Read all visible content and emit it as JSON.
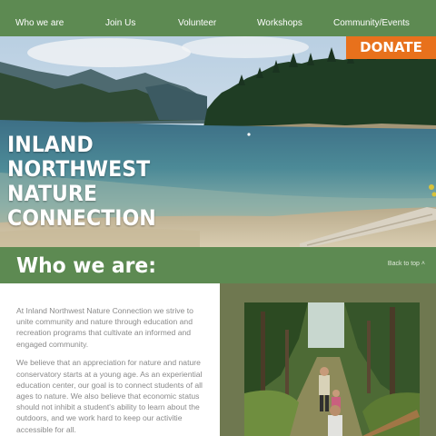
{
  "nav": {
    "items": [
      {
        "label": "Who we are"
      },
      {
        "label": "Join Us"
      },
      {
        "label": "Volunteer"
      },
      {
        "label": "Workshops"
      },
      {
        "label": "Community/Events"
      }
    ]
  },
  "donate_label": "DONATE",
  "hero": {
    "title_lines": [
      "INLAND",
      "NORTHWEST",
      "NATURE",
      "CONNECTION"
    ]
  },
  "section": {
    "title": "Who we are:",
    "back_link": "Back to top"
  },
  "body": {
    "paragraph_1": "At Inland Northwest Nature Connection we strive to unite community and nature through education and recreation programs that cultivate an informed and engaged community.",
    "paragraph_2": "We believe that an appreciation for nature and nature conservatory starts at a young age. As an experiential education center, our goal is to connect students of all ages to nature.  We also believe that economic status should not inhibit a student's ability to learn about the outdoors, and we work hard to keep our activitie accessible for all."
  },
  "colors": {
    "nav_green": "#5d8a52",
    "donate_orange": "#e8711c",
    "content_olive": "#6f7850"
  }
}
